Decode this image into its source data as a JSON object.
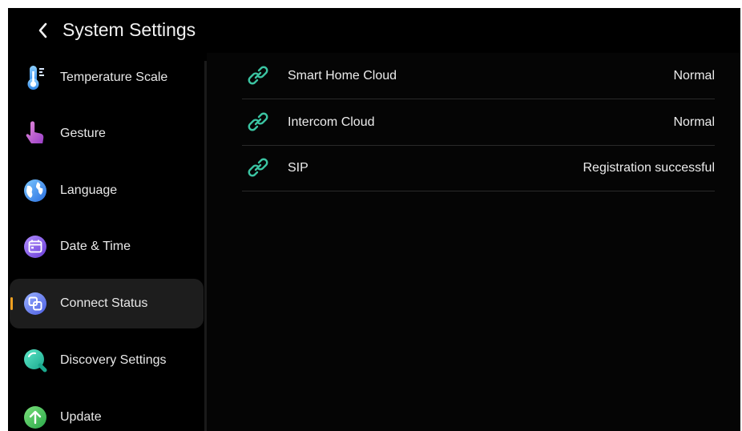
{
  "header": {
    "title": "System Settings",
    "back_icon": "chevron-left-icon"
  },
  "sidebar": {
    "active_index": 4,
    "accent_color": "#f0a020",
    "items": [
      {
        "label": "Temperature Scale",
        "icon": "thermometer-icon"
      },
      {
        "label": "Gesture",
        "icon": "hand-pointer-icon"
      },
      {
        "label": "Language",
        "icon": "globe-icon"
      },
      {
        "label": "Date & Time",
        "icon": "calendar-icon"
      },
      {
        "label": "Connect Status",
        "icon": "connect-status-icon"
      },
      {
        "label": "Discovery Settings",
        "icon": "discovery-icon"
      },
      {
        "label": "Update",
        "icon": "update-arrow-icon"
      }
    ]
  },
  "main": {
    "link_color": "#3bc4a2",
    "rows": [
      {
        "label": "Smart Home Cloud",
        "value": "Normal",
        "icon": "link-icon"
      },
      {
        "label": "Intercom Cloud",
        "value": "Normal",
        "icon": "link-icon"
      },
      {
        "label": "SIP",
        "value": "Registration successful",
        "icon": "link-icon"
      }
    ]
  }
}
